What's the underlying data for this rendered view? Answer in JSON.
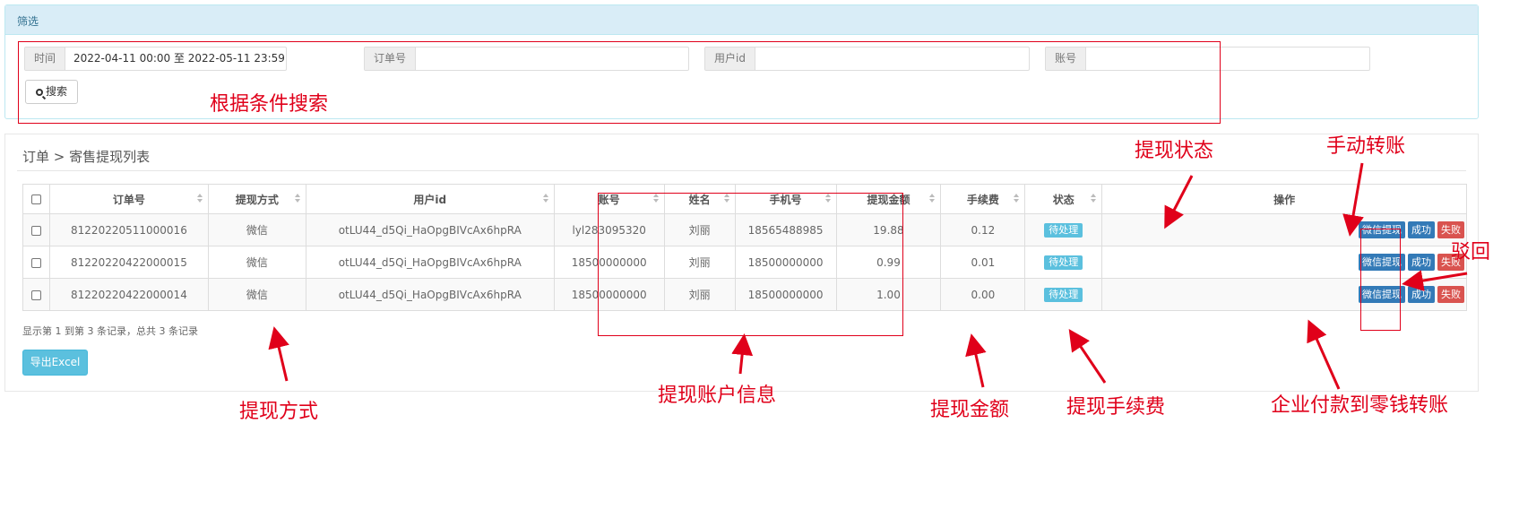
{
  "filter": {
    "title": "筛选",
    "time_label": "时间",
    "time_value": "2022-04-11 00:00 至 2022-05-11 23:59",
    "order_label": "订单号",
    "order_value": "",
    "userid_label": "用户id",
    "userid_value": "",
    "account_label": "账号",
    "account_value": "",
    "search_label": "搜索"
  },
  "breadcrumb": "订单 > 寄售提现列表",
  "table": {
    "headers": [
      "订单号",
      "提现方式",
      "用户id",
      "账号",
      "姓名",
      "手机号",
      "提现金额",
      "手续费",
      "状态",
      "操作"
    ],
    "rows": [
      [
        "81220220511000016",
        "微信",
        "otLU44_d5Qi_HaOpgBIVcAx6hpRA",
        "lyl283095320",
        "刘丽",
        "18565488985",
        "19.88",
        "0.12",
        "待处理"
      ],
      [
        "81220220422000015",
        "微信",
        "otLU44_d5Qi_HaOpgBIVcAx6hpRA",
        "18500000000",
        "刘丽",
        "18500000000",
        "0.99",
        "0.01",
        "待处理"
      ],
      [
        "81220220422000014",
        "微信",
        "otLU44_d5Qi_HaOpgBIVcAx6hpRA",
        "18500000000",
        "刘丽",
        "18500000000",
        "1.00",
        "0.00",
        "待处理"
      ]
    ],
    "actions": [
      "微信提现",
      "成功",
      "失败"
    ]
  },
  "pagination_info": "显示第 1 到第 3 条记录，总共 3 条记录",
  "export_label": "导出Excel",
  "annotations": {
    "search": "根据条件搜索",
    "status": "提现状态",
    "manual": "手动转账",
    "reject": "驳回",
    "method": "提现方式",
    "account_info": "提现账户信息",
    "amount": "提现金额",
    "fee": "提现手续费",
    "enterprise": "企业付款到零钱转账"
  },
  "colors": {
    "annotation_red": "#e0001a",
    "info": "#5bc0de",
    "primary": "#337ab7",
    "danger": "#d9534f"
  }
}
